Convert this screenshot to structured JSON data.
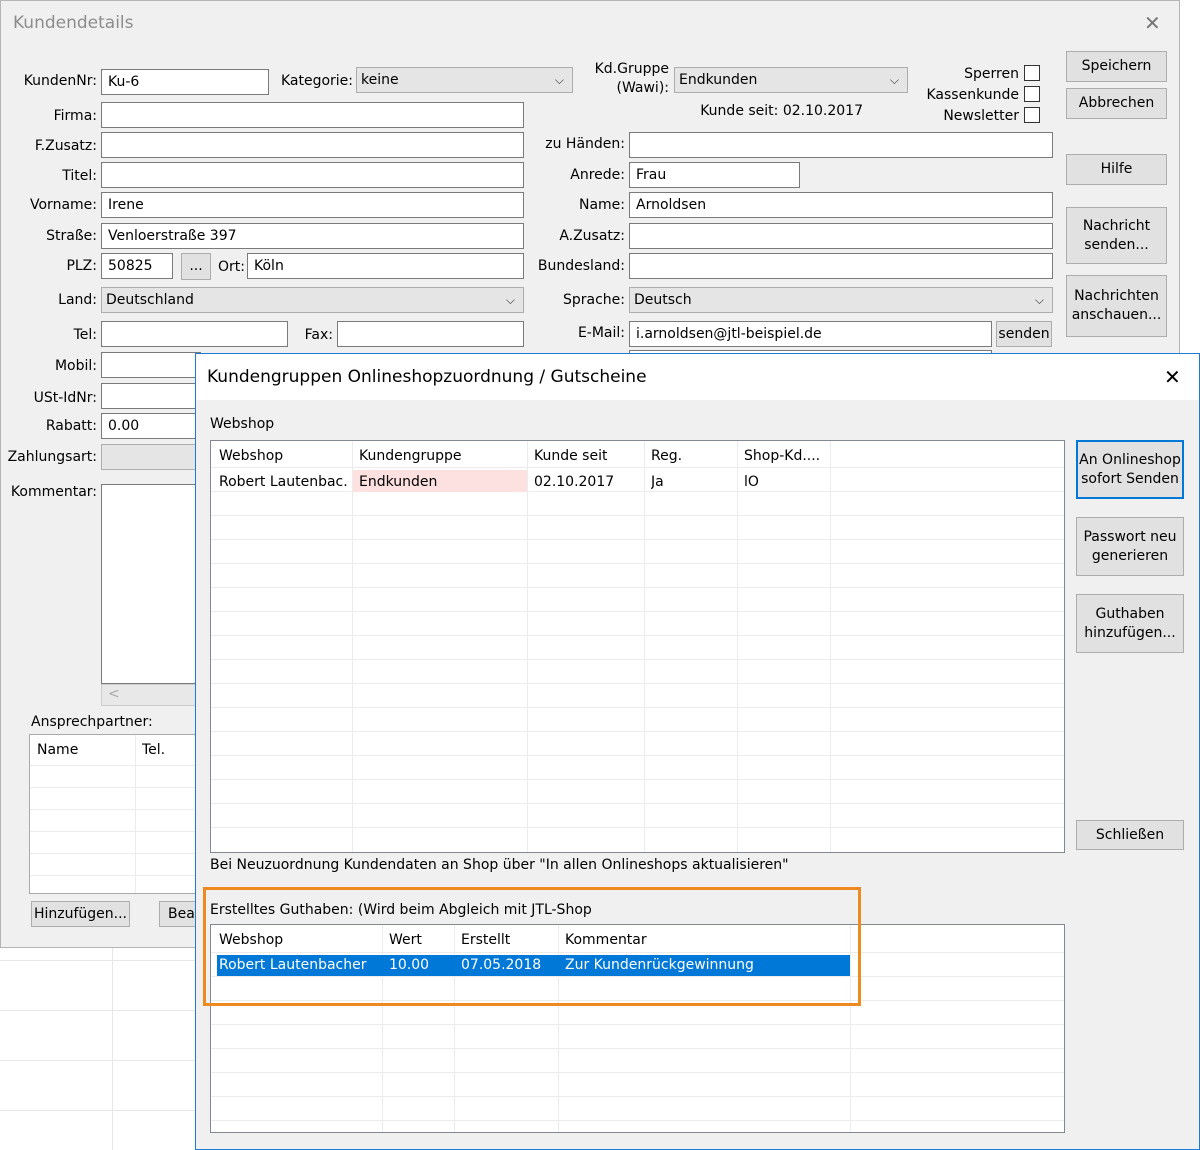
{
  "main_dialog": {
    "title": "Kundendetails",
    "close_symbol": "✕",
    "labels": {
      "kundennr": "KundenNr:",
      "kategorie": "Kategorie:",
      "kdgruppe_line1": "Kd.Gruppe",
      "kdgruppe_line2": "(Wawi):",
      "firma": "Firma:",
      "fzusatz": "F.Zusatz:",
      "titel": "Titel:",
      "vorname": "Vorname:",
      "strasse": "Straße:",
      "plz": "PLZ:",
      "ort": "Ort:",
      "land": "Land:",
      "tel": "Tel:",
      "fax": "Fax:",
      "mobil": "Mobil:",
      "ustid": "USt-IdNr:",
      "rabatt": "Rabatt:",
      "zahlungsart": "Zahlungsart:",
      "kommentar": "Kommentar:",
      "zu_haenden": "zu Händen:",
      "anrede": "Anrede:",
      "name": "Name:",
      "azusatz": "A.Zusatz:",
      "bundesland": "Bundesland:",
      "sprache": "Sprache:",
      "email": "E-Mail:",
      "sperren": "Sperren",
      "kassenkunde": "Kassenkunde",
      "newsletter": "Newsletter",
      "ansprechpartner": "Ansprechpartner:"
    },
    "values": {
      "kundennr": "Ku-6",
      "kategorie": "keine",
      "kdgruppe": "Endkunden",
      "kunde_seit": "Kunde seit: 02.10.2017",
      "firma": "",
      "fzusatz": "",
      "titel": "",
      "vorname": "Irene",
      "strasse": "Venloerstraße 397",
      "plz": "50825",
      "ort": "Köln",
      "land": "Deutschland",
      "tel": "",
      "fax": "",
      "rabatt": "0.00",
      "zu_haenden": "",
      "anrede": "Frau",
      "name": "Arnoldsen",
      "azusatz": "",
      "bundesland": "",
      "sprache": "Deutsch",
      "email": "i.arnoldsen@jtl-beispiel.de"
    },
    "buttons": {
      "plz_lookup": "...",
      "senden": "senden",
      "speichern": "Speichern",
      "abbrechen": "Abbrechen",
      "hilfe": "Hilfe",
      "nachricht_line1": "Nachricht",
      "nachricht_line2": "senden...",
      "nachrichten_line1": "Nachrichten",
      "nachrichten_line2": "anschauen...",
      "hinzufuegen": "Hinzufügen...",
      "bearbeiten_partial": "Bear"
    },
    "ansprechpartner_columns": [
      "Name",
      "Tel."
    ]
  },
  "overlay_dialog": {
    "title": "Kundengruppen Onlineshopzuordnung / Gutscheine",
    "close_symbol": "✕",
    "webshop_label": "Webshop",
    "webshop_table": {
      "columns": [
        "Webshop",
        "Kundengruppe",
        "Kunde seit",
        "Reg.",
        "Shop-Kd...."
      ],
      "rows": [
        [
          "Robert Lautenbac...",
          "Endkunden",
          "02.10.2017",
          "Ja",
          "lO"
        ]
      ]
    },
    "note": "Bei Neuzuordnung Kundendaten an Shop über \"In allen Onlineshops aktualisieren\"",
    "guthaben_label": "Erstelltes Guthaben: (Wird beim Abgleich mit JTL-Shop",
    "guthaben_table": {
      "columns": [
        "Webshop",
        "Wert",
        "Erstellt",
        "Kommentar"
      ],
      "rows": [
        [
          "Robert Lautenbacher",
          "10.00",
          "07.05.2018",
          "Zur Kundenrückgewinnung"
        ]
      ]
    },
    "buttons": {
      "an_onlineshop_line1": "An Onlineshop",
      "an_onlineshop_line2": "sofort Senden",
      "passwort_line1": "Passwort neu",
      "passwort_line2": "generieren",
      "guthaben_line1": "Guthaben",
      "guthaben_line2": "hinzufügen...",
      "schliessen": "Schließen"
    },
    "colors": {
      "selection": "#0078d7",
      "highlight_cell": "#fde0e0",
      "annotation_border": "#ee8a1f",
      "dialog_border": "#1e7ad3"
    }
  },
  "icons": {
    "chevron": "⌵",
    "scroll_left": "<"
  }
}
